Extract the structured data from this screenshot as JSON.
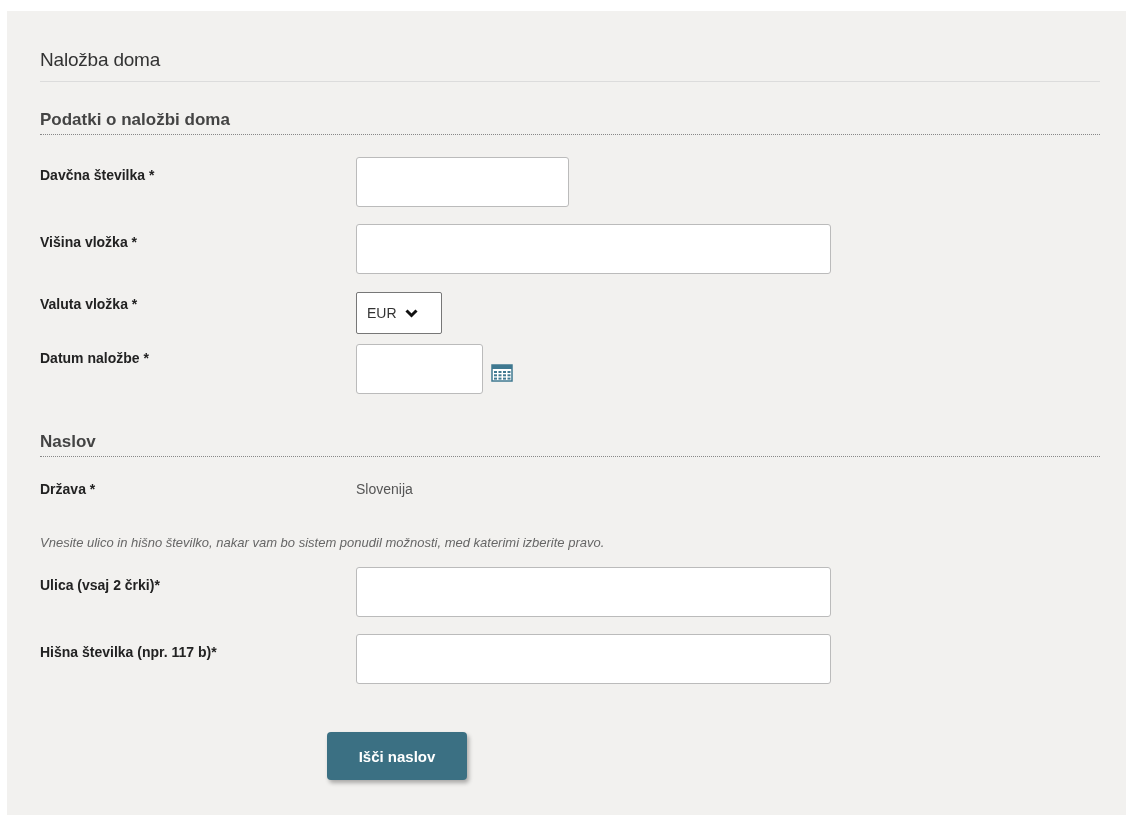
{
  "title": "Naložba doma",
  "sections": [
    {
      "heading": "Podatki o naložbi doma",
      "fields": [
        {
          "kind": "short-text",
          "label": "Davčna številka *"
        },
        {
          "kind": "text",
          "label": "Višina vložka *"
        },
        {
          "kind": "select",
          "label": "Valuta vložka *",
          "value": "EUR"
        },
        {
          "kind": "date",
          "label": "Datum naložbe *"
        }
      ]
    },
    {
      "heading": "Naslov",
      "fields": [
        {
          "kind": "static",
          "label": "Država *",
          "value": "Slovenija"
        },
        {
          "kind": "hint",
          "text": "Vnesite ulico in hišno številko, nakar vam bo sistem ponudil možnosti, med katerimi izberite pravo."
        },
        {
          "kind": "text",
          "label": "Ulica (vsaj 2 črki)*"
        },
        {
          "kind": "text",
          "label": "Hišna številka (npr. 117 b)*"
        }
      ]
    }
  ],
  "button": "Išči naslov"
}
